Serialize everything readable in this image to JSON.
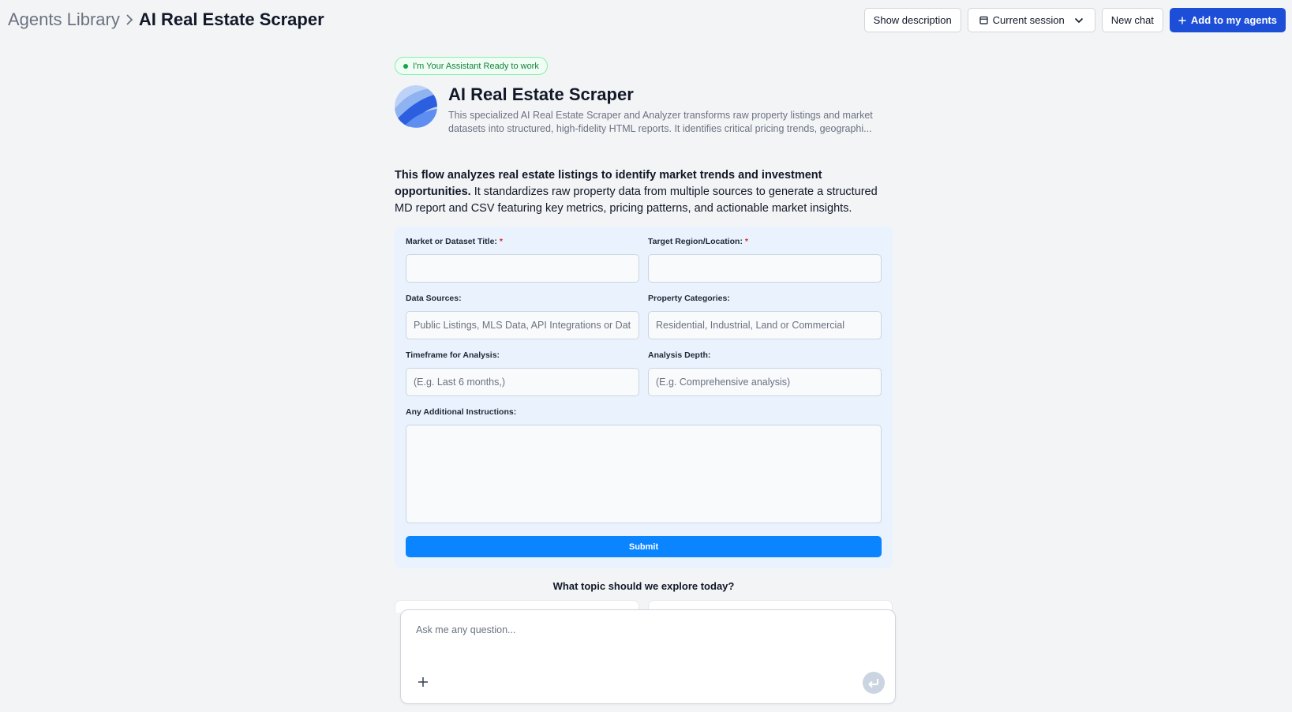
{
  "breadcrumb": {
    "root": "Agents Library",
    "current": "AI Real Estate Scraper"
  },
  "header_actions": {
    "show_description": "Show description",
    "current_session": "Current session",
    "new_chat": "New chat",
    "add_to_agents": "Add to my agents"
  },
  "status_pill": "I'm Your Assistant Ready to work",
  "agent": {
    "title": "AI Real Estate Scraper",
    "description": "This specialized AI Real Estate Scraper and Analyzer transforms raw property listings and market datasets into structured, high-fidelity HTML reports. It identifies critical pricing trends, geographi..."
  },
  "flow": {
    "bold": "This flow analyzes real estate listings to identify market trends and investment opportunities.",
    "rest": "It standardizes raw property data from multiple sources to generate a structured MD report and CSV featuring key metrics, pricing patterns, and actionable market insights."
  },
  "form": {
    "market_title_label": "Market or Dataset Title:",
    "region_label": "Target Region/Location:",
    "data_sources_label": "Data Sources:",
    "data_sources_placeholder": "Public Listings, MLS Data, API Integrations or Dat",
    "property_categories_label": "Property Categories:",
    "property_categories_placeholder": "Residential, Industrial, Land or Commercial",
    "timeframe_label": "Timeframe for Analysis:",
    "timeframe_placeholder": "(E.g. Last 6 months,)",
    "depth_label": "Analysis Depth:",
    "depth_placeholder": "(E.g. Comprehensive analysis)",
    "instructions_label": "Any Additional Instructions:",
    "required_mark": "*",
    "submit": "Submit"
  },
  "explore_heading": "What topic should we explore today?",
  "chat": {
    "placeholder": "Ask me any question..."
  },
  "colors": {
    "primary": "#1d4ed8",
    "submit": "#0a84ff",
    "form_bg": "#eaf3fd",
    "ready_green": "#16a34a"
  }
}
